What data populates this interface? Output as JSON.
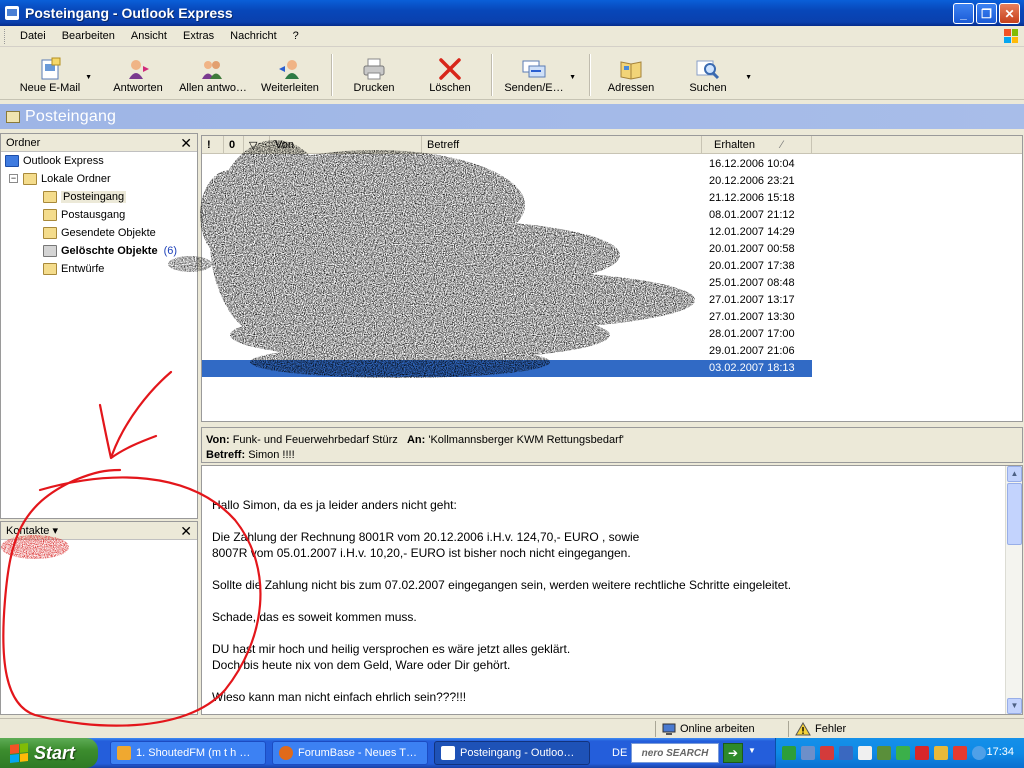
{
  "window": {
    "title": "Posteingang - Outlook Express"
  },
  "menu": [
    "Datei",
    "Bearbeiten",
    "Ansicht",
    "Extras",
    "Nachricht",
    "?"
  ],
  "toolbar": {
    "new_mail": "Neue E-Mail",
    "reply": "Antworten",
    "reply_all": "Allen antwo…",
    "forward": "Weiterleiten",
    "print": "Drucken",
    "delete": "Löschen",
    "send_receive": "Senden/E…",
    "addresses": "Adressen",
    "search": "Suchen"
  },
  "folder_header": "Posteingang",
  "folders": {
    "title": "Ordner",
    "close": "✕",
    "items": [
      {
        "label": "Outlook Express"
      },
      {
        "label": "Lokale Ordner"
      },
      {
        "label": "Posteingang"
      },
      {
        "label": "Postausgang"
      },
      {
        "label": "Gesendete Objekte"
      },
      {
        "label": "Gelöschte Objekte",
        "count": "(6)"
      },
      {
        "label": "Entwürfe"
      }
    ]
  },
  "contacts": {
    "title": "Kontakte ▾",
    "close": "✕"
  },
  "message_list": {
    "columns": {
      "priority": "!",
      "attachment": "0",
      "flag": "▽",
      "from": "Von",
      "subject": "Betreff",
      "received": "Erhalten"
    },
    "sort_indicator": "⁄",
    "rows": [
      {
        "received": "16.12.2006 10:04"
      },
      {
        "received": "20.12.2006 23:21"
      },
      {
        "received": "21.12.2006 15:18"
      },
      {
        "received": "08.01.2007 21:12"
      },
      {
        "received": "12.01.2007 14:29"
      },
      {
        "received": "20.01.2007 00:58"
      },
      {
        "received": "20.01.2007 17:38"
      },
      {
        "received": "25.01.2007 08:48"
      },
      {
        "received": "27.01.2007 13:17"
      },
      {
        "received": "27.01.2007 13:30"
      },
      {
        "received": "28.01.2007 17:00"
      },
      {
        "received": "29.01.2007 21:06"
      },
      {
        "received": "03.02.2007 18:13"
      }
    ]
  },
  "preview": {
    "from_label": "Von:",
    "from": "Funk- und Feuerwehrbedarf Stürz",
    "to_label": "An:",
    "to": "'Kollmannsberger KWM Rettungsbedarf'",
    "subject_label": "Betreff:",
    "subject": "Simon !!!!",
    "body": [
      [
        "Hallo Simon, da es ja leider anders nicht geht:"
      ],
      [
        "Die Zahlung der Rechnung 8001R vom 20.12.2006 i.H.v. 124,70,- EURO , sowie",
        "8007R vom 05.01.2007 i.H.v. 10,20,- EURO ist bisher noch nicht eingegangen."
      ],
      [
        "Sollte die Zahlung nicht bis zum 07.02.2007 eingegangen sein, werden weitere rechtliche Schritte eingeleitet."
      ],
      [
        "Schade, das es soweit kommen muss."
      ],
      [
        "DU hast mir hoch und heilig versprochen es wäre jetzt alles geklärt.",
        "Doch bis heute nix von dem Geld, Ware oder Dir gehört."
      ],
      [
        "Wieso kann man nicht einfach ehrlich sein???!!!"
      ]
    ]
  },
  "statusbar": {
    "online": "Online arbeiten",
    "error": "Fehler"
  },
  "taskbar": {
    "start": "Start",
    "tasks": [
      "1. ShoutedFM (m t h …",
      "ForumBase - Neues T…",
      "Posteingang - Outloo…"
    ],
    "language": "DE",
    "search_brand": "nero SEARCH",
    "clock": "17:34"
  },
  "colors": {
    "selection": "#316ac5",
    "title_blue": "#0847b9",
    "taskbar_blue": "#245edb",
    "annotation_red": "#e3161b"
  }
}
